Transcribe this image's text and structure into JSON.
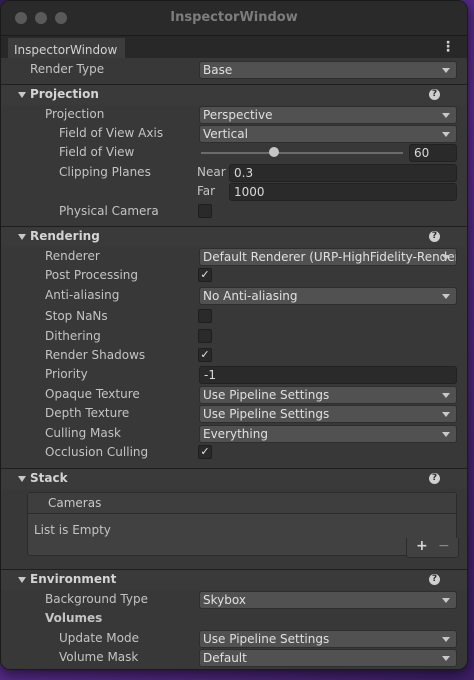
{
  "window": {
    "title": "InspectorWindow",
    "tab_label": "InspectorWindow",
    "menu_icon": "kebab-menu-icon"
  },
  "render_type": {
    "label": "Render Type",
    "value": "Base"
  },
  "projection": {
    "header": "Projection",
    "projection_label": "Projection",
    "projection_value": "Perspective",
    "fov_axis_label": "Field of View Axis",
    "fov_axis_value": "Vertical",
    "fov_label": "Field of View",
    "fov_value": "60",
    "fov_level": 0.36,
    "clipping_label": "Clipping Planes",
    "near_label": "Near",
    "near_value": "0.3",
    "far_label": "Far",
    "far_value": "1000",
    "physical_camera_label": "Physical Camera",
    "physical_camera_checked": false
  },
  "rendering": {
    "header": "Rendering",
    "renderer_label": "Renderer",
    "renderer_value": "Default Renderer (URP-HighFidelity-Renderer)",
    "post_processing_label": "Post Processing",
    "post_processing_checked": true,
    "anti_aliasing_label": "Anti-aliasing",
    "anti_aliasing_value": "No Anti-aliasing",
    "stop_nans_label": "Stop NaNs",
    "stop_nans_checked": false,
    "dithering_label": "Dithering",
    "dithering_checked": false,
    "render_shadows_label": "Render Shadows",
    "render_shadows_checked": true,
    "priority_label": "Priority",
    "priority_value": "-1",
    "opaque_texture_label": "Opaque Texture",
    "opaque_texture_value": "Use Pipeline Settings",
    "depth_texture_label": "Depth Texture",
    "depth_texture_value": "Use Pipeline Settings",
    "culling_mask_label": "Culling Mask",
    "culling_mask_value": "Everything",
    "occlusion_culling_label": "Occlusion Culling",
    "occlusion_culling_checked": true
  },
  "stack": {
    "header": "Stack",
    "list_header": "Cameras",
    "empty_text": "List is Empty",
    "add": "+",
    "remove": "−"
  },
  "environment": {
    "header": "Environment",
    "background_type_label": "Background Type",
    "background_type_value": "Skybox",
    "volumes_label": "Volumes",
    "update_mode_label": "Update Mode",
    "update_mode_value": "Use Pipeline Settings",
    "volume_mask_label": "Volume Mask",
    "volume_mask_value": "Default"
  },
  "check_glyph": "✓",
  "help_glyph": "?",
  "colors": {
    "panel": "#383838",
    "titlebar": "#2a2a2a",
    "dropdown": "#515151",
    "field": "#2a2a2a",
    "background": "#4a2a78"
  }
}
